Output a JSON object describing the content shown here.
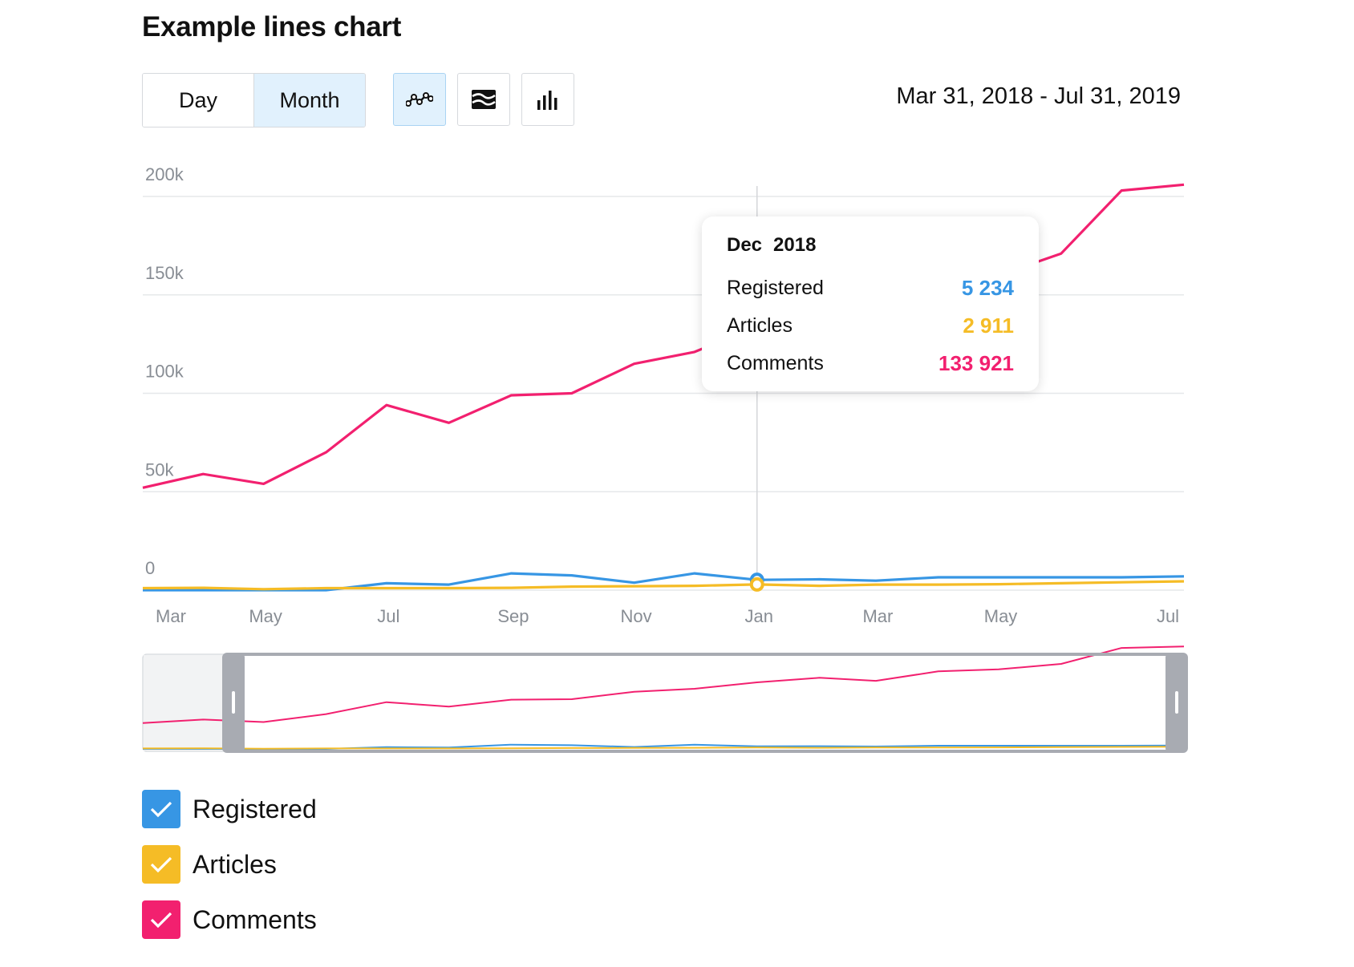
{
  "title": "Example lines chart",
  "period_buttons": [
    {
      "label": "Day",
      "active": false
    },
    {
      "label": "Month",
      "active": true
    }
  ],
  "chart_type_buttons": [
    {
      "icon": "line-chart-icon",
      "active": true
    },
    {
      "icon": "area-chart-icon",
      "active": false
    },
    {
      "icon": "bar-chart-icon",
      "active": false
    }
  ],
  "date_range": "Mar 31, 2018 - Jul 31, 2019",
  "colors": {
    "registered": "#3796e4",
    "articles": "#f5bc26",
    "comments": "#f2206f",
    "active_button_bg": "#e1f1fd"
  },
  "tooltip": {
    "month": "Dec",
    "year": "2018",
    "rows": [
      {
        "label": "Registered",
        "value": "5 234",
        "color": "#3796e4"
      },
      {
        "label": "Articles",
        "value": "2 911",
        "color": "#f5bc26"
      },
      {
        "label": "Comments",
        "value": "133 921",
        "color": "#f2206f"
      }
    ]
  },
  "legend": [
    {
      "label": "Registered",
      "color": "#3796e4",
      "checked": true
    },
    {
      "label": "Articles",
      "color": "#f5bc26",
      "checked": true
    },
    {
      "label": "Comments",
      "color": "#f2206f",
      "checked": true
    }
  ],
  "chart_data": {
    "type": "line",
    "title": "Example lines chart",
    "xlabel": "",
    "ylabel": "",
    "x": [
      "2018-03-01",
      "2018-03-31",
      "2018-04-30",
      "2018-05-31",
      "2018-06-30",
      "2018-07-31",
      "2018-08-31",
      "2018-09-30",
      "2018-10-31",
      "2018-11-30",
      "2018-12-31",
      "2019-01-31",
      "2019-02-28",
      "2019-03-31",
      "2019-04-30",
      "2019-05-31",
      "2019-06-30",
      "2019-07-31"
    ],
    "xticks": [
      "Mar",
      "May",
      "Jul",
      "Sep",
      "Nov",
      "Jan",
      "Mar",
      "May",
      "Jul"
    ],
    "xtick_dates": [
      "2018-03-01",
      "2018-05-01",
      "2018-07-01",
      "2018-09-01",
      "2018-11-01",
      "2019-01-01",
      "2019-03-01",
      "2019-05-01",
      "2019-07-31"
    ],
    "yticks": [
      "0",
      "50k",
      "100k",
      "150k",
      "200k"
    ],
    "ytick_values": [
      0,
      50000,
      100000,
      150000,
      200000
    ],
    "ylim": [
      0,
      200000
    ],
    "xlim": [
      "2018-03-01",
      "2019-07-31"
    ],
    "grid": true,
    "hover_date": "2018-12-31",
    "series": [
      {
        "name": "Registered",
        "color": "#3796e4",
        "values": [
          0,
          0,
          0,
          0,
          3500,
          2800,
          8500,
          7500,
          3800,
          8500,
          5234,
          5500,
          4800,
          6500,
          6500,
          6500,
          6500,
          7000
        ]
      },
      {
        "name": "Articles",
        "color": "#f5bc26",
        "values": [
          1000,
          1200,
          500,
          1000,
          1000,
          1000,
          1200,
          1800,
          2000,
          2200,
          2911,
          2200,
          2800,
          2800,
          3000,
          3500,
          4000,
          4500
        ]
      },
      {
        "name": "Comments",
        "color": "#f2206f",
        "values": [
          52000,
          59000,
          54000,
          70000,
          94000,
          85000,
          99000,
          100000,
          115000,
          121000,
          133921,
          143000,
          137000,
          156000,
          160000,
          171000,
          203000,
          206000
        ]
      }
    ]
  }
}
